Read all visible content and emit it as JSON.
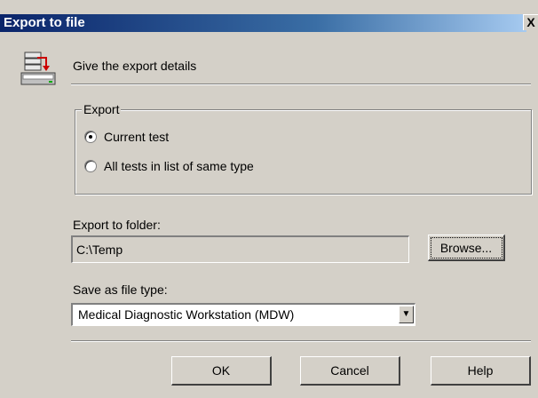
{
  "window": {
    "title": "Export to file",
    "close_glyph": "X"
  },
  "header": {
    "text": "Give the export details",
    "icon": "export-to-disk-icon"
  },
  "export_group": {
    "legend": "Export",
    "options": [
      {
        "label": "Current test",
        "checked": true
      },
      {
        "label": "All tests in list of same type",
        "checked": false
      }
    ]
  },
  "folder": {
    "label": "Export to folder:",
    "value": "C:\\Temp",
    "browse_label": "Browse..."
  },
  "file_type": {
    "label": "Save as file type:",
    "selected": "Medical Diagnostic Workstation (MDW)"
  },
  "buttons": {
    "ok": "OK",
    "cancel": "Cancel",
    "help": "Help"
  },
  "colors": {
    "dialog_bg": "#d4d0c8",
    "title_start": "#0a246a",
    "title_end": "#a6caf0"
  }
}
